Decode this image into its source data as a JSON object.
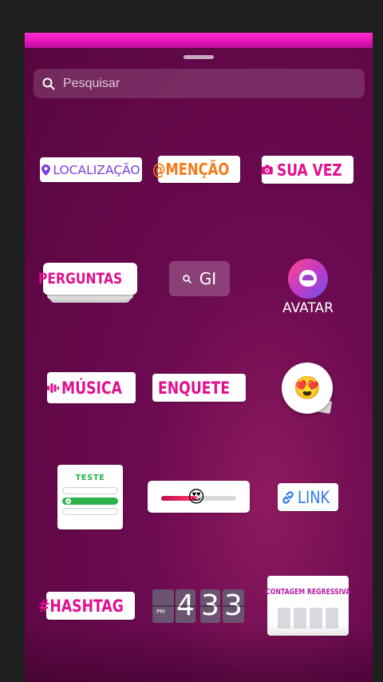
{
  "search": {
    "placeholder": "Pesquisar",
    "value": ""
  },
  "stickers": {
    "location": "LOCALIZAÇÃO",
    "mention": "@MENÇÃO",
    "your_turn": "SUA VEZ",
    "questions": "PERGUNTAS",
    "gif": "GI",
    "avatar": "AVATAR",
    "music": "MÚSICA",
    "poll": "ENQUETE",
    "emoji_reaction": "😍",
    "quiz": "TESTE",
    "slider_emoji": "😍",
    "slider_level": 0.48,
    "link": "LINK",
    "hashtag": "#HASHTAG",
    "countdown": "CONTAGEM REGRESSIVA",
    "time": {
      "ampm": "PM",
      "h": "4",
      "m1": "3",
      "m2": "3"
    }
  },
  "colors": {
    "sheet_bg": "#6c0a52",
    "top_bar": "#e313b5",
    "accent_pink": "#e0118f",
    "location_purple": "#7b3fe0",
    "mention_orange": "#f47b1b",
    "link_blue": "#2c7be5",
    "quiz_green": "#2bb24a"
  }
}
